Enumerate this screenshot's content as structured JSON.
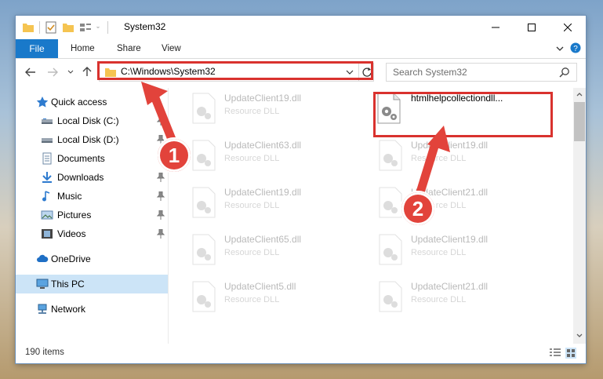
{
  "window": {
    "title": "System32"
  },
  "ribbon": {
    "tabs": [
      "File",
      "Home",
      "Share",
      "View"
    ]
  },
  "nav": {
    "address": "C:\\Windows\\System32",
    "search_placeholder": "Search System32"
  },
  "sidebar": {
    "items": [
      {
        "label": "Quick access",
        "icon": "star-icon",
        "pinned": false
      },
      {
        "label": "Local Disk (C:)",
        "icon": "drive-icon",
        "pinned": true
      },
      {
        "label": "Local Disk (D:)",
        "icon": "drive-icon",
        "pinned": true
      },
      {
        "label": "Documents",
        "icon": "documents-icon",
        "pinned": true
      },
      {
        "label": "Downloads",
        "icon": "downloads-icon",
        "pinned": true
      },
      {
        "label": "Music",
        "icon": "music-icon",
        "pinned": true
      },
      {
        "label": "Pictures",
        "icon": "pictures-icon",
        "pinned": true
      },
      {
        "label": "Videos",
        "icon": "videos-icon",
        "pinned": true
      },
      {
        "label": "OneDrive",
        "icon": "cloud-icon",
        "pinned": false
      },
      {
        "label": "This PC",
        "icon": "computer-icon",
        "pinned": false,
        "selected": true
      },
      {
        "label": "Network",
        "icon": "network-icon",
        "pinned": false
      }
    ]
  },
  "files": [
    {
      "name": "UpdateClient19.dll",
      "type": "Resource DLL"
    },
    {
      "name": "htmlhelpcollectiondll...",
      "type": ""
    },
    {
      "name": "UpdateClient63.dll",
      "type": "Resource DLL"
    },
    {
      "name": "UpdateClient19.dll",
      "type": "Resource DLL"
    },
    {
      "name": "UpdateClient19.dll",
      "type": "Resource DLL"
    },
    {
      "name": "UpdateClient21.dll",
      "type": "Resource DLL"
    },
    {
      "name": "UpdateClient65.dll",
      "type": "Resource DLL"
    },
    {
      "name": "UpdateClient19.dll",
      "type": "Resource DLL"
    },
    {
      "name": "UpdateClient5.dll",
      "type": "Resource DLL"
    },
    {
      "name": "UpdateClient21.dll",
      "type": "Resource DLL"
    }
  ],
  "status": {
    "item_count": "190 items"
  },
  "annotations": {
    "step1": "1",
    "step2": "2",
    "color": "#d9322e"
  }
}
